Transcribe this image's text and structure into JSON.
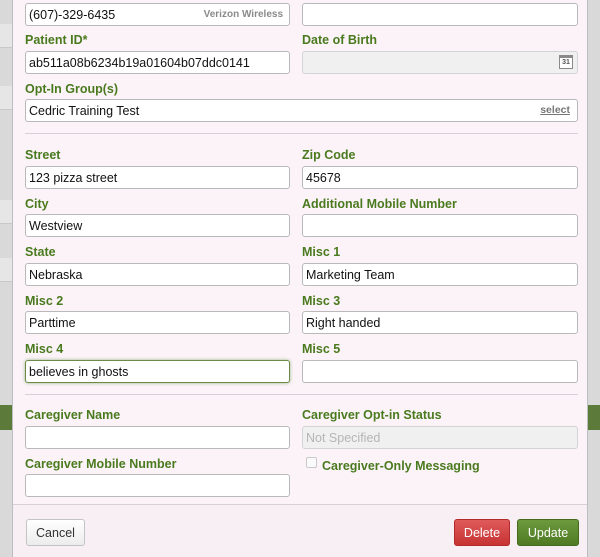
{
  "contact": {
    "phone_value": "(607)-329-6435",
    "carrier": "Verizon Wireless",
    "top_right_value": ""
  },
  "patient_id": {
    "label": "Patient ID*",
    "value": "ab511a08b6234b19a01604b07ddc0141"
  },
  "dob": {
    "label": "Date of Birth",
    "value": "",
    "icon": "calendar-icon",
    "icon_text": "31"
  },
  "opt_in": {
    "label": "Opt-In Group(s)",
    "value": "Cedric Training Test",
    "select_label": "select"
  },
  "address": {
    "street": {
      "label": "Street",
      "value": "123 pizza street"
    },
    "zip": {
      "label": "Zip Code",
      "value": "45678"
    },
    "city": {
      "label": "City",
      "value": "Westview"
    },
    "additional_mobile": {
      "label": "Additional Mobile Number",
      "value": ""
    },
    "state": {
      "label": "State",
      "value": "Nebraska"
    },
    "misc1": {
      "label": "Misc 1",
      "value": "Marketing Team"
    },
    "misc2": {
      "label": "Misc 2",
      "value": "Parttime"
    },
    "misc3": {
      "label": "Misc 3",
      "value": "Right handed"
    },
    "misc4": {
      "label": "Misc 4",
      "value": "believes in ghosts"
    },
    "misc5": {
      "label": "Misc 5",
      "value": ""
    }
  },
  "caregiver": {
    "name": {
      "label": "Caregiver Name",
      "value": ""
    },
    "opt_in_status": {
      "label": "Caregiver Opt-in Status",
      "placeholder": "Not Specified"
    },
    "mobile": {
      "label": "Caregiver Mobile Number",
      "value": ""
    },
    "only_messaging": {
      "label": "Caregiver-Only Messaging",
      "checked": false
    }
  },
  "footer": {
    "cancel_label": "Cancel",
    "delete_label": "Delete",
    "update_label": "Update"
  },
  "colors": {
    "label_green": "#4a7a1e",
    "update_green": "#5a8a2e",
    "delete_red": "#d14444",
    "modal_bg": "#fbf3f8"
  }
}
